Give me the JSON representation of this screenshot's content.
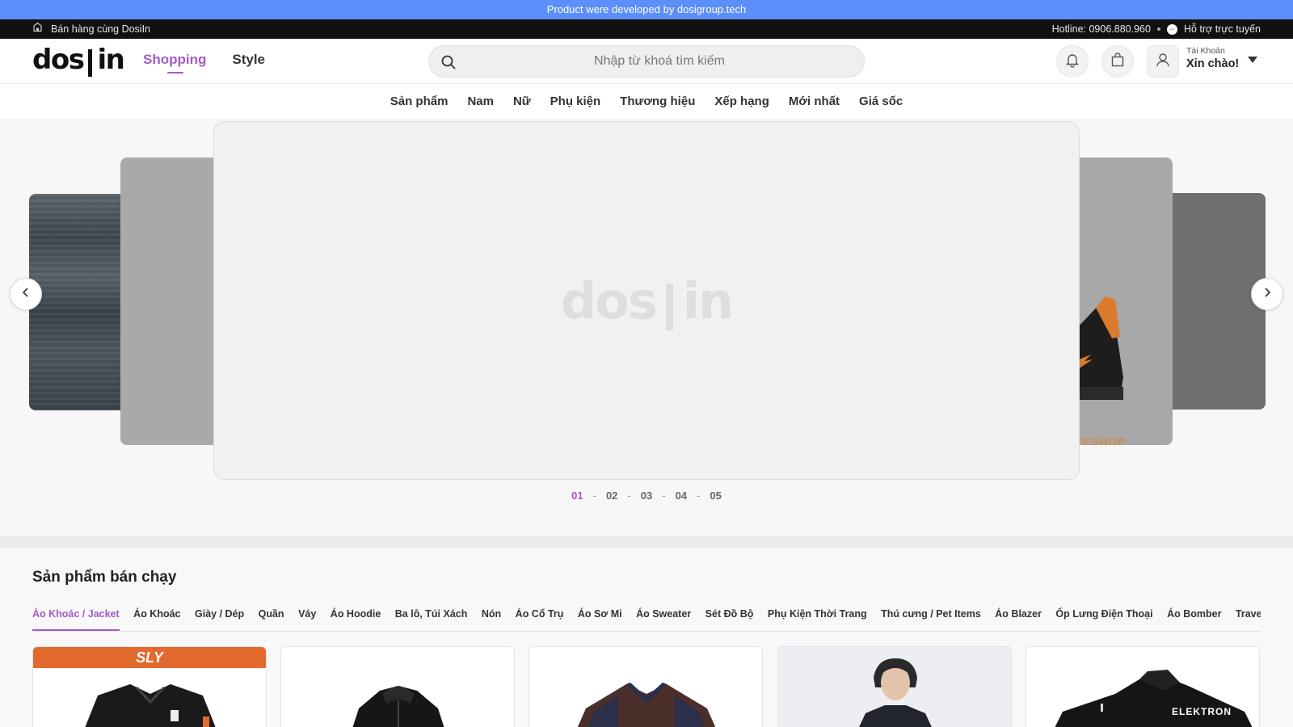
{
  "promo_banner": "Product were developed by dosigroup.tech",
  "topbar": {
    "sell_label": "Bán hàng cùng DosiIn",
    "hotline": "Hotline: 0906.880.960",
    "support": "Hỗ trợ trực tuyến"
  },
  "header": {
    "logo_left": "dos",
    "logo_right": "in",
    "modes": [
      "Shopping",
      "Style"
    ],
    "active_mode": "Shopping",
    "search": {
      "placeholder": "Nhập từ khoá tìm kiếm",
      "value": ""
    },
    "account": {
      "label": "Tài Khoản",
      "greeting": "Xin chào!"
    }
  },
  "category_nav": [
    "Sản phẩm",
    "Nam",
    "Nữ",
    "Phụ kiện",
    "Thương hiệu",
    "Xếp hạng",
    "Mới nhất",
    "Giá sốc"
  ],
  "hero": {
    "placeholder_logo_left": "dos",
    "placeholder_logo_right": "in",
    "side_slide_text": "TESHOP",
    "pager": [
      "01",
      "02",
      "03",
      "04",
      "05"
    ],
    "active_page": "01"
  },
  "best_sellers": {
    "title": "Sản phẩm bán chạy",
    "tabs": [
      "Áo Khoác / Jacket",
      "Áo Khoác",
      "Giày / Dép",
      "Quần",
      "Váy",
      "Áo Hoodie",
      "Ba lô, Túi Xách",
      "Nón",
      "Áo Cổ Trụ",
      "Áo Sơ Mi",
      "Áo Sweater",
      "Sét Đồ Bộ",
      "Phụ Kiện Thời Trang",
      "Thú cưng / Pet Items",
      "Áo Blazer",
      "Ốp Lưng Điện Thoại",
      "Áo Bomber",
      "Travel Tag, Gối du"
    ],
    "active_tab": "Áo Khoác / Jacket",
    "card_texts": {
      "brand_tag": "SLY",
      "elektron": "ELEKTRON"
    }
  },
  "colors": {
    "accent": "#a35bc6",
    "promo": "#5b8ff9",
    "topbar": "#111111"
  }
}
